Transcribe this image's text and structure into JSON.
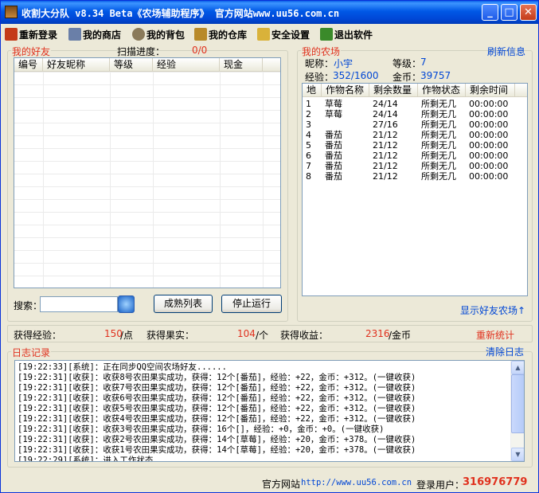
{
  "window": {
    "title": "收割大分队 v8.34  Beta《农场辅助程序》 官方网站www.uu56.com.cn"
  },
  "toolbar": [
    {
      "label": "重新登录",
      "icon": "relogin-icon",
      "color": "#c43b18"
    },
    {
      "label": "我的商店",
      "icon": "cart-icon",
      "color": "#6a7fa8"
    },
    {
      "label": "我的背包",
      "icon": "bag-icon",
      "color": "#8a7a5a"
    },
    {
      "label": "我的仓库",
      "icon": "warehouse-icon",
      "color": "#b88a2a"
    },
    {
      "label": "安全设置",
      "icon": "key-icon",
      "color": "#d9b23a"
    },
    {
      "label": "退出软件",
      "icon": "exit-icon",
      "color": "#3a8a2a"
    }
  ],
  "friends": {
    "legend": "我的好友",
    "scan_label": "扫描进度：",
    "scan_value": "0/0",
    "columns": [
      "编号",
      "好友昵称",
      "等级",
      "经验",
      "现金"
    ],
    "search_label": "搜索：",
    "search_value": "",
    "ripe_button": "成熟列表",
    "stop_button": "停止运行"
  },
  "farm": {
    "legend": "我的农场",
    "refresh": "刷新信息",
    "nick_label": "昵称：",
    "nick": "小宇",
    "level_label": "等级：",
    "level": "7",
    "exp_label": "经验：",
    "exp": "352/1600",
    "gold_label": "金币：",
    "gold": "39757",
    "columns": [
      "地",
      "作物名称",
      "剩余数量",
      "作物状态",
      "剩余时间"
    ],
    "rows": [
      [
        "1",
        "草莓",
        "24/14",
        "所剩无几",
        "00:00:00"
      ],
      [
        "2",
        "草莓",
        "24/14",
        "所剩无几",
        "00:00:00"
      ],
      [
        "3",
        "",
        "27/16",
        "所剩无几",
        "00:00:00"
      ],
      [
        "4",
        "番茄",
        "21/12",
        "所剩无几",
        "00:00:00"
      ],
      [
        "5",
        "番茄",
        "21/12",
        "所剩无几",
        "00:00:00"
      ],
      [
        "6",
        "番茄",
        "21/12",
        "所剩无几",
        "00:00:00"
      ],
      [
        "7",
        "番茄",
        "21/12",
        "所剩无几",
        "00:00:00"
      ],
      [
        "8",
        "番茄",
        "21/12",
        "所剩无几",
        "00:00:00"
      ]
    ],
    "show_friend_farm": "显示好友农场↑"
  },
  "stats": {
    "exp_label": "获得经验：",
    "exp_value": "150",
    "exp_unit": "/点",
    "fruit_label": "获得果实：",
    "fruit_value": "104",
    "fruit_unit": "/个",
    "income_label": "获得收益：",
    "income_value": "2316",
    "income_unit": "/金币",
    "reset": "重新统计"
  },
  "log": {
    "legend": "日志记录",
    "clear": "清除日志",
    "lines": [
      "[19:22:33][系统]：正在同步QQ空间农场好友......",
      "[19:22:31][收获]：收获8号农田果实成功，获得：12个[番茄]，经验：+22，金币：+312。(一键收获)",
      "[19:22:31][收获]：收获7号农田果实成功，获得：12个[番茄]，经验：+22，金币：+312。(一键收获)",
      "[19:22:31][收获]：收获6号农田果实成功，获得：12个[番茄]，经验：+22，金币：+312。(一键收获)",
      "[19:22:31][收获]：收获5号农田果实成功，获得：12个[番茄]，经验：+22，金币：+312。(一键收获)",
      "[19:22:31][收获]：收获4号农田果实成功，获得：12个[番茄]，经验：+22，金币：+312。(一键收获)",
      "[19:22:31][收获]：收获3号农田果实成功，获得：16个[]，经验：+0，金币：+0。(一键收获)",
      "[19:22:31][收获]：收获2号农田果实成功，获得：14个[草莓]，经验：+20，金币：+378。(一键收获)",
      "[19:22:31][收获]：收获1号农田果实成功，获得：14个[草莓]，经验：+20，金币：+378。(一键收获)",
      "[19:22:29][系统]：进入工作状态"
    ]
  },
  "statusbar": {
    "site_label": "官方网站",
    "site_url": "http://www.uu56.com.cn",
    "user_label": "登录用户：",
    "user": "316976779"
  }
}
